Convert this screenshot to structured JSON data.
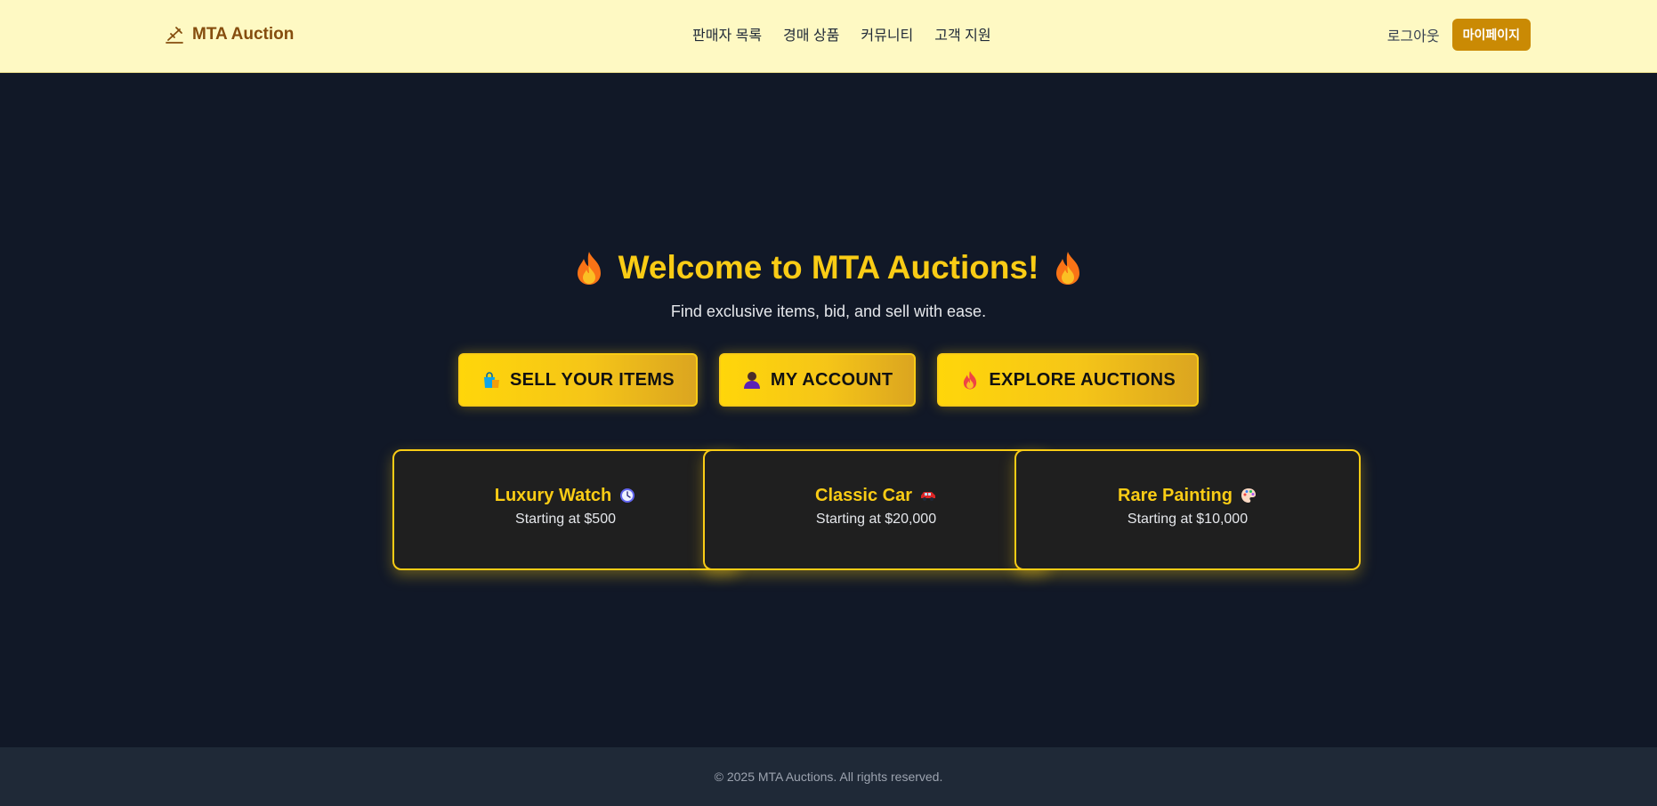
{
  "navbar": {
    "brand": "MTA Auction",
    "links": [
      "판매자 목록",
      "경매 상품",
      "커뮤니티",
      "고객 지원"
    ],
    "logout": "로그아웃",
    "mypage": "마이페이지"
  },
  "hero": {
    "title": "Welcome to MTA Auctions!",
    "subtitle": "Find exclusive items, bid, and sell with ease."
  },
  "cta": [
    {
      "label": "SELL YOUR ITEMS",
      "icon": "shopping-bags-icon"
    },
    {
      "label": "MY ACCOUNT",
      "icon": "user-icon"
    },
    {
      "label": "EXPLORE AUCTIONS",
      "icon": "fire-icon"
    }
  ],
  "items": [
    {
      "title": "Luxury Watch",
      "price": "Starting at $500",
      "icon": "watch-icon"
    },
    {
      "title": "Classic Car",
      "price": "Starting at $20,000",
      "icon": "car-icon"
    },
    {
      "title": "Rare Painting",
      "price": "Starting at $10,000",
      "icon": "palette-icon"
    }
  ],
  "footer": {
    "text": "© 2025 MTA Auctions. All rights reserved."
  },
  "colors": {
    "navbar_bg": "#fef9c3",
    "brand": "#854d0e",
    "accent": "#facc15",
    "button_primary": "#ca8a04",
    "page_bg": "#111827",
    "card_bg": "#1f1f1f",
    "footer_bg": "#1f2937"
  }
}
